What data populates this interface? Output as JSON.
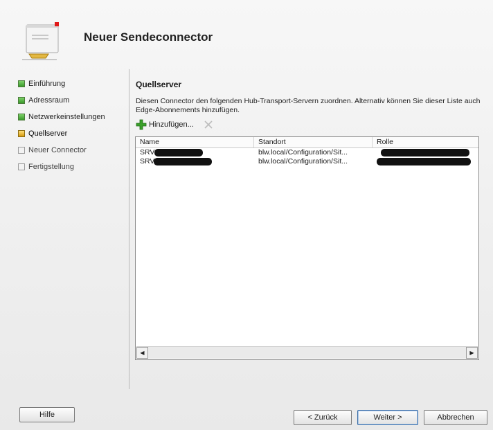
{
  "window": {
    "title": "Neuer Sendeconnector"
  },
  "nav": {
    "items": [
      {
        "label": "Einführung",
        "state": "done"
      },
      {
        "label": "Adressraum",
        "state": "done"
      },
      {
        "label": "Netzwerkeinstellungen",
        "state": "done"
      },
      {
        "label": "Quellserver",
        "state": "current"
      },
      {
        "label": "Neuer Connector",
        "state": "pending"
      },
      {
        "label": "Fertigstellung",
        "state": "pending"
      }
    ]
  },
  "main": {
    "title": "Quellserver",
    "description": "Diesen Connector den folgenden Hub-Transport-Servern zuordnen. Alternativ können Sie dieser Liste auch Edge-Abonnements hinzufügen.",
    "toolbar": {
      "add_label": "Hinzufügen..."
    },
    "table": {
      "columns": [
        "Name",
        "Standort",
        "Rolle"
      ],
      "rows": [
        {
          "name": "SRV",
          "site": "blw.local/Configuration/Sit...",
          "role": ""
        },
        {
          "name": "SRV",
          "site": "blw.local/Configuration/Sit...",
          "role": ""
        }
      ]
    }
  },
  "buttons": {
    "help": "Hilfe",
    "back": "< Zurück",
    "next": "Weiter >",
    "cancel": "Abbrechen"
  },
  "colors": {
    "step_done": "#3a9a2a",
    "step_current": "#d69a10",
    "add_icon": "#3aa02a",
    "default_button_border": "#3d6fa8"
  }
}
